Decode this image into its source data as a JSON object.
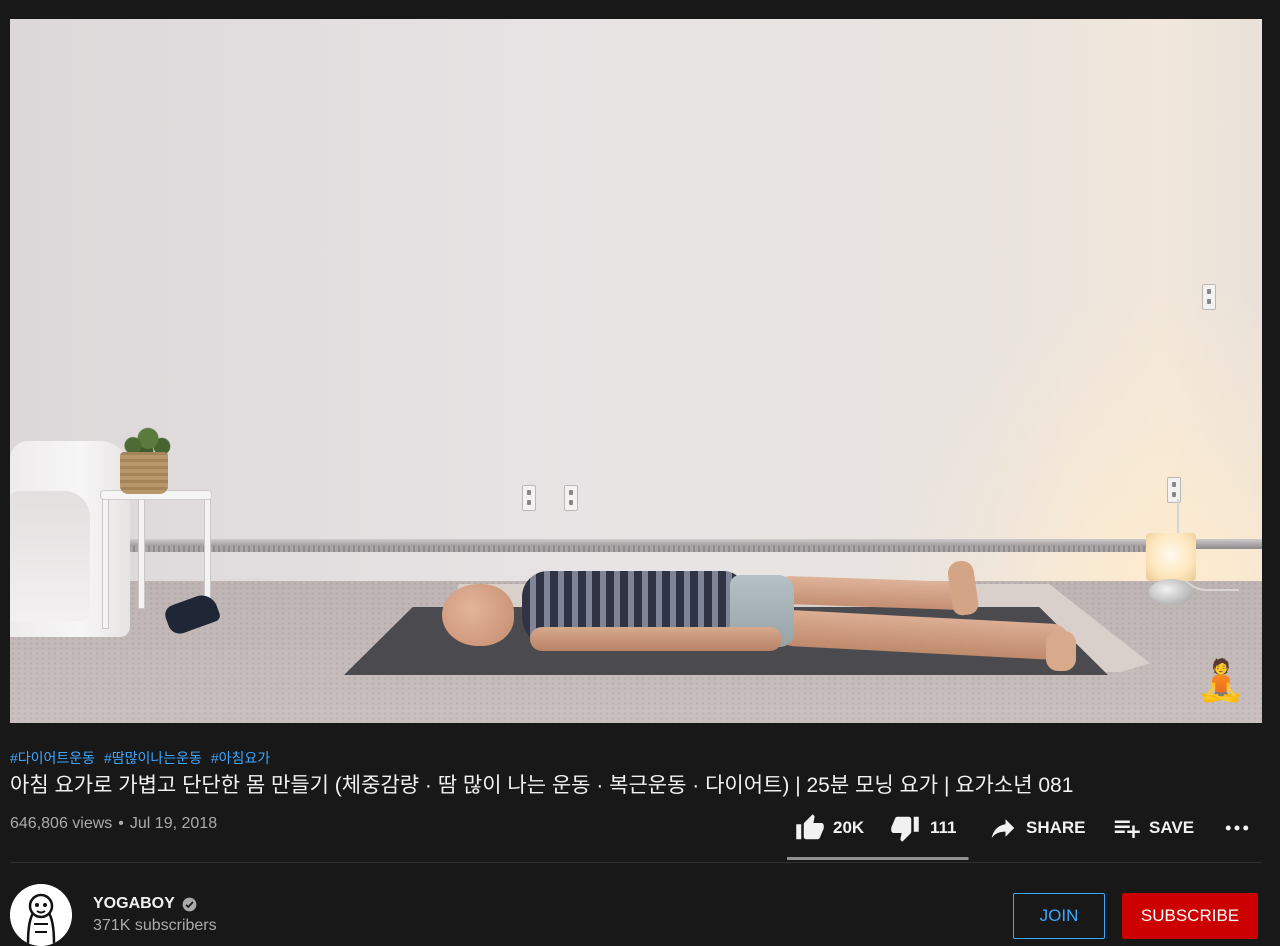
{
  "video": {
    "hashtags": [
      "#다이어트운동",
      "#땀많이나는운동",
      "#아침요가"
    ],
    "title": "아침 요가로 가볍고 단단한 몸 만들기 (체중감량 · 땀 많이 나는 운동 · 복근운동 · 다이어트) | 25분 모닝 요가 | 요가소년 081",
    "views": "646,806 views",
    "date": "Jul 19, 2018",
    "separator": "•"
  },
  "actions": {
    "likes": "20K",
    "dislikes": "111",
    "share_label": "SHARE",
    "save_label": "SAVE",
    "like_ratio": 0.994,
    "icons": [
      "thumb-up-icon",
      "thumb-down-icon",
      "share-arrow-icon",
      "playlist-add-icon",
      "more-horiz-icon"
    ]
  },
  "channel": {
    "name": "YOGABOY",
    "verified": true,
    "subscribers": "371K subscribers",
    "join_label": "JOIN",
    "subscribe_label": "SUBSCRIBE"
  },
  "colors": {
    "background": "#181818",
    "accent_link": "#3ea6ff",
    "subscribe_red": "#cc0000",
    "text_primary": "#f1f1f1",
    "text_secondary": "#aaaaaa"
  }
}
